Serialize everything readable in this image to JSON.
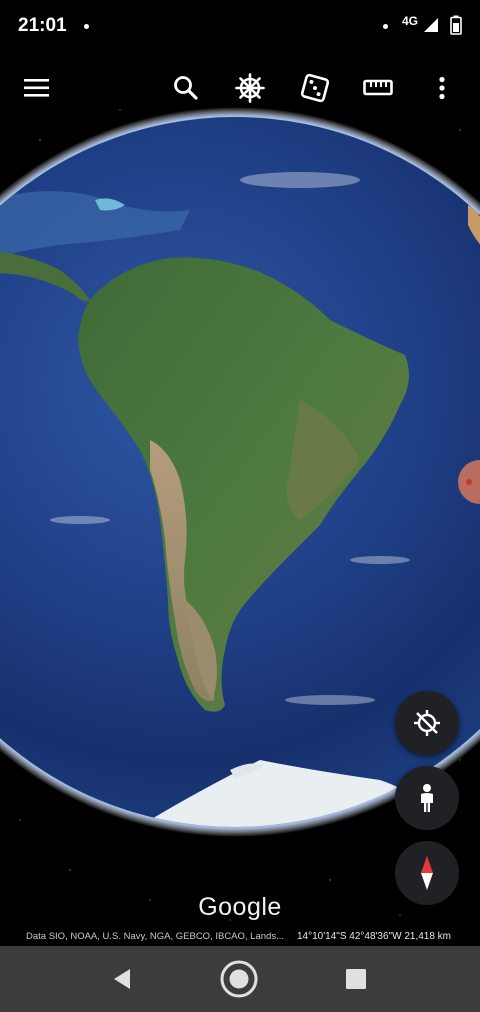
{
  "status_bar": {
    "time": "21:01",
    "network": "4G",
    "icons": [
      "notification-dot",
      "signal-icon",
      "battery-icon"
    ]
  },
  "toolbar": {
    "menu_icon": "menu-icon",
    "search_icon": "search-icon",
    "voyager_icon": "ship-wheel-icon",
    "feeling_lucky_icon": "dice-icon",
    "measure_icon": "ruler-icon",
    "more_icon": "more-vertical-icon"
  },
  "map": {
    "logo": "Google",
    "attribution": "Data SIO, NOAA, U.S. Navy, NGA, GEBCO, IBCAO, Lands...",
    "coordinates": "14°10'14\"S 42°48'36\"W 21,418 km"
  },
  "controls": {
    "location_icon": "my-location-off-icon",
    "street_view_icon": "pegman-icon",
    "compass_icon": "compass-icon"
  },
  "nav": {
    "back_icon": "back-triangle-icon",
    "home_icon": "home-circle-icon",
    "recents_icon": "recents-square-icon"
  },
  "colors": {
    "background": "#000000",
    "fab_bg": "#202124",
    "nav_bg": "#3c3c3c",
    "compass_red": "#e53935"
  }
}
